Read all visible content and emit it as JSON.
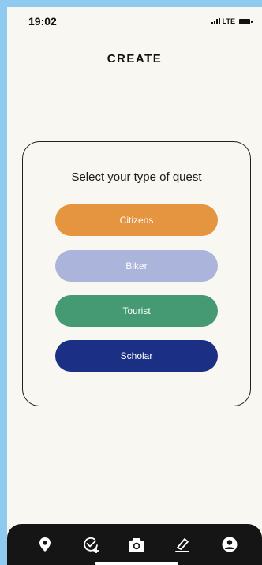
{
  "status_bar": {
    "time": "19:02",
    "network": "LTE"
  },
  "header": {
    "title": "CREATE"
  },
  "quest_card": {
    "heading": "Select your type of quest",
    "options": [
      {
        "label": "Citizens",
        "color": "#e5943f"
      },
      {
        "label": "Biker",
        "color": "#abb4db"
      },
      {
        "label": "Tourist",
        "color": "#459a74"
      },
      {
        "label": "Scholar",
        "color": "#1b2f84"
      }
    ]
  },
  "bottom_nav": {
    "items": [
      {
        "icon": "map-pin-icon"
      },
      {
        "icon": "add-check-icon"
      },
      {
        "icon": "camera-icon"
      },
      {
        "icon": "edit-icon"
      },
      {
        "icon": "profile-icon"
      }
    ],
    "background": "#151515"
  }
}
